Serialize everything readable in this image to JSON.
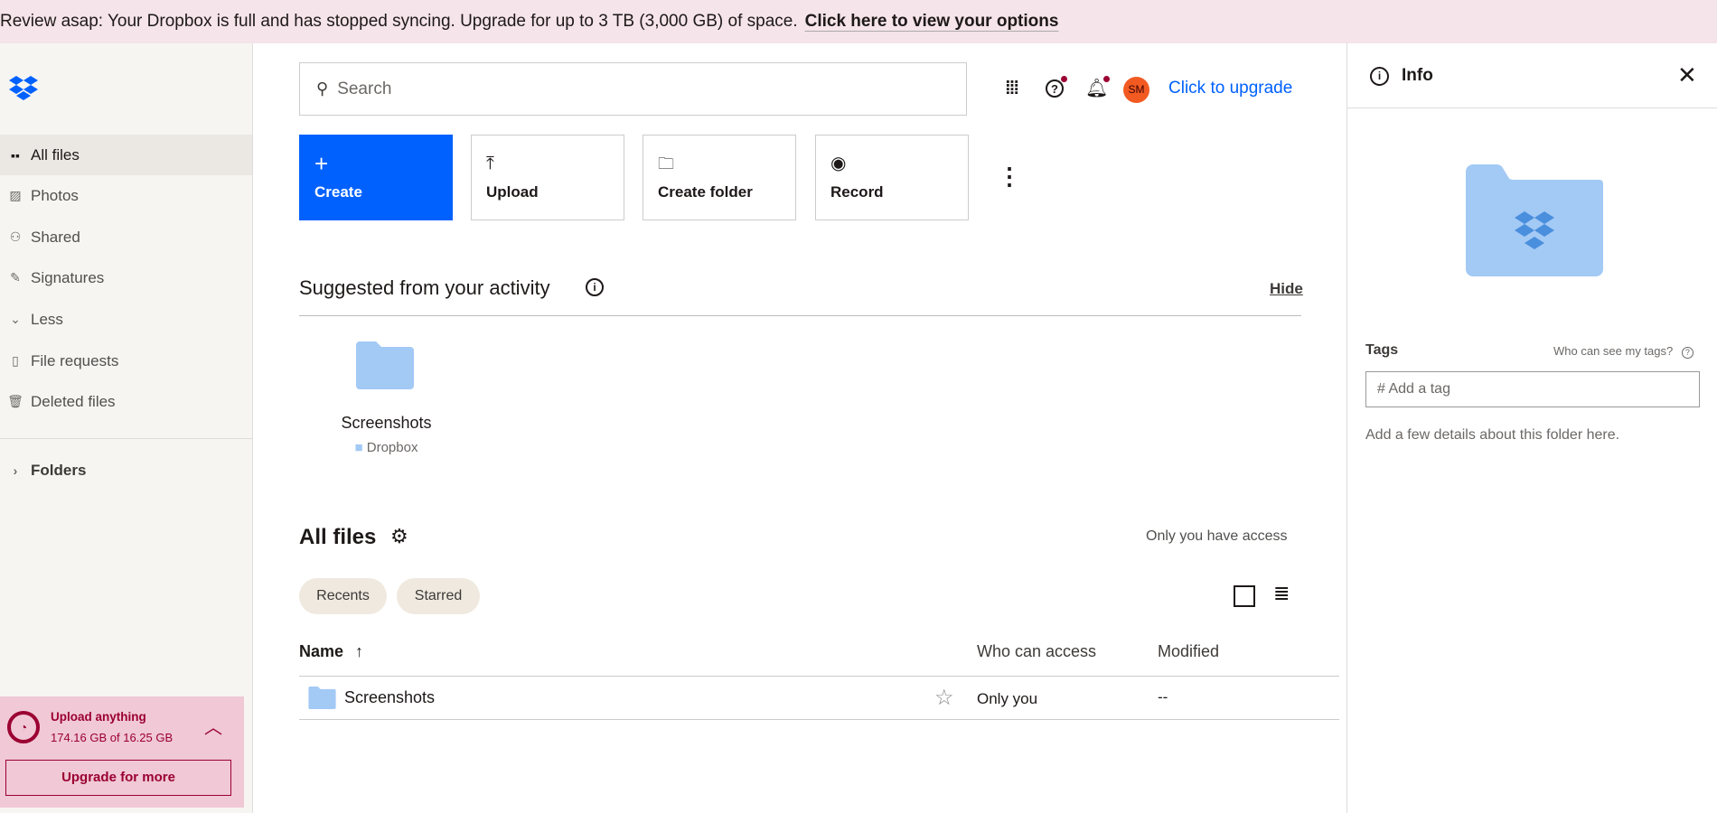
{
  "banner": {
    "message": "Review asap: Your Dropbox is full and has stopped syncing. Upgrade for up to 3 TB (3,000 GB) of space.",
    "link": "Click here to view your options"
  },
  "sidebar": {
    "items": [
      {
        "label": "All files",
        "icon": "all-files-icon",
        "active": true
      },
      {
        "label": "Photos",
        "icon": "photos-icon"
      },
      {
        "label": "Shared",
        "icon": "shared-icon"
      },
      {
        "label": "Signatures",
        "icon": "signatures-icon"
      },
      {
        "label": "Less",
        "icon": "chevron-down-icon"
      },
      {
        "label": "File requests",
        "icon": "file-request-icon"
      },
      {
        "label": "Deleted files",
        "icon": "trash-icon"
      }
    ],
    "folders": "Folders",
    "upload": {
      "title": "Upload anything",
      "usage": "174.16 GB of 16.25 GB",
      "button": "Upgrade for more"
    }
  },
  "header": {
    "search_placeholder": "Search",
    "avatar": "SM",
    "upgrade": "Click to upgrade"
  },
  "actions": {
    "create": "Create",
    "upload": "Upload",
    "create_folder": "Create folder",
    "record": "Record"
  },
  "suggested": {
    "title": "Suggested from your activity",
    "hide": "Hide",
    "item": {
      "name": "Screenshots",
      "location": "Dropbox"
    }
  },
  "files": {
    "title": "All files",
    "access": "Only you have access",
    "chips": [
      "Recents",
      "Starred"
    ],
    "columns": {
      "name": "Name",
      "access": "Who can access",
      "modified": "Modified"
    },
    "rows": [
      {
        "name": "Screenshots",
        "access": "Only you",
        "modified": "--"
      }
    ]
  },
  "panel": {
    "title": "Info",
    "tags_label": "Tags",
    "tags_help": "Who can see my tags?",
    "tag_placeholder": "# Add a tag",
    "details": "Add a few details about this folder here."
  },
  "colors": {
    "accent": "#0061fe",
    "banner": "#f5e4ea",
    "warning": "#9b0032",
    "avatar": "#f25a22",
    "folder": "#a3c9f5"
  }
}
